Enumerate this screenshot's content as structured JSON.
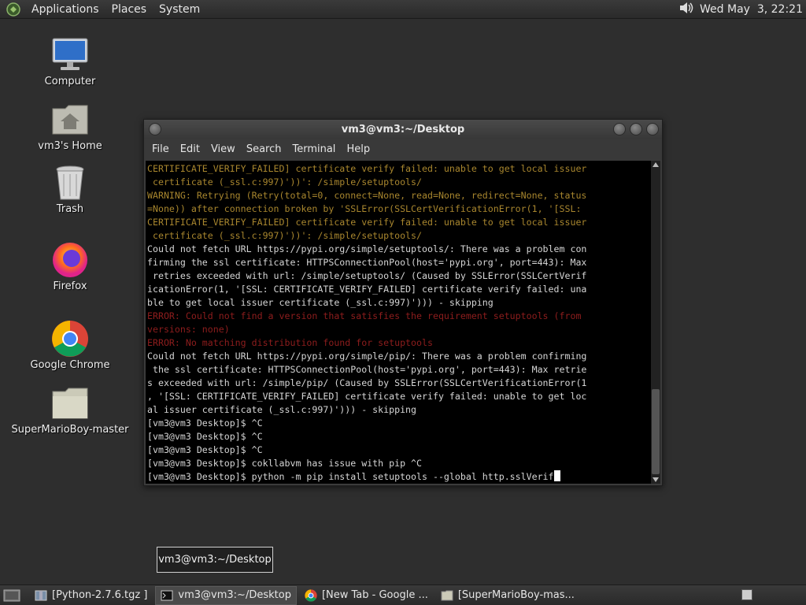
{
  "top_panel": {
    "menu": [
      "Applications",
      "Places",
      "System"
    ],
    "clock": "Wed May  3, 22:21"
  },
  "desktop_icons": [
    {
      "label": "Computer",
      "icon": "computer-icon"
    },
    {
      "label": "vm3's Home",
      "icon": "home-folder-icon"
    },
    {
      "label": "Trash",
      "icon": "trash-icon"
    },
    {
      "label": "Firefox",
      "icon": "firefox-icon"
    },
    {
      "label": "Google Chrome",
      "icon": "chrome-icon"
    },
    {
      "label": "SuperMarioBoy-master",
      "icon": "folder-icon"
    }
  ],
  "terminal": {
    "title": "vm3@vm3:~/Desktop",
    "menu": [
      "File",
      "Edit",
      "View",
      "Search",
      "Terminal",
      "Help"
    ],
    "lines": [
      {
        "t": "CERTIFICATE_VERIFY_FAILED] certificate verify failed: unable to get local issuer",
        "c": "warn"
      },
      {
        "t": " certificate (_ssl.c:997)'))': /simple/setuptools/",
        "c": "warn"
      },
      {
        "t": "WARNING: Retrying (Retry(total=0, connect=None, read=None, redirect=None, status",
        "c": "warn"
      },
      {
        "t": "=None)) after connection broken by 'SSLError(SSLCertVerificationError(1, '[SSL:",
        "c": "warn"
      },
      {
        "t": "CERTIFICATE_VERIFY_FAILED] certificate verify failed: unable to get local issuer",
        "c": "warn"
      },
      {
        "t": " certificate (_ssl.c:997)'))': /simple/setuptools/",
        "c": "warn"
      },
      {
        "t": "Could not fetch URL https://pypi.org/simple/setuptools/: There was a problem con",
        "c": "norm"
      },
      {
        "t": "firming the ssl certificate: HTTPSConnectionPool(host='pypi.org', port=443): Max",
        "c": "norm"
      },
      {
        "t": " retries exceeded with url: /simple/setuptools/ (Caused by SSLError(SSLCertVerif",
        "c": "norm"
      },
      {
        "t": "icationError(1, '[SSL: CERTIFICATE_VERIFY_FAILED] certificate verify failed: una",
        "c": "norm"
      },
      {
        "t": "ble to get local issuer certificate (_ssl.c:997)'))) - skipping",
        "c": "norm"
      },
      {
        "t": "ERROR: Could not find a version that satisfies the requirement setuptools (from",
        "c": "err"
      },
      {
        "t": "versions: none)",
        "c": "err"
      },
      {
        "t": "ERROR: No matching distribution found for setuptools",
        "c": "err"
      },
      {
        "t": "Could not fetch URL https://pypi.org/simple/pip/: There was a problem confirming",
        "c": "norm"
      },
      {
        "t": " the ssl certificate: HTTPSConnectionPool(host='pypi.org', port=443): Max retrie",
        "c": "norm"
      },
      {
        "t": "s exceeded with url: /simple/pip/ (Caused by SSLError(SSLCertVerificationError(1",
        "c": "norm"
      },
      {
        "t": ", '[SSL: CERTIFICATE_VERIFY_FAILED] certificate verify failed: unable to get loc",
        "c": "norm"
      },
      {
        "t": "al issuer certificate (_ssl.c:997)'))) - skipping",
        "c": "norm"
      },
      {
        "t": "[vm3@vm3 Desktop]$ ^C",
        "c": "norm"
      },
      {
        "t": "[vm3@vm3 Desktop]$ ^C",
        "c": "norm"
      },
      {
        "t": "[vm3@vm3 Desktop]$ ^C",
        "c": "norm"
      },
      {
        "t": "[vm3@vm3 Desktop]$ cokllabvm has issue with pip ^C",
        "c": "norm"
      },
      {
        "t": "[vm3@vm3 Desktop]$ python -m pip install setuptools --global http.sslVerif",
        "c": "norm",
        "cursor": true
      }
    ]
  },
  "tooltip": "vm3@vm3:~/Desktop",
  "taskbar": [
    {
      "label": "[Python-2.7.6.tgz ]",
      "icon": "archive-icon",
      "active": false
    },
    {
      "label": "vm3@vm3:~/Desktop",
      "icon": "terminal-icon",
      "active": true
    },
    {
      "label": "[New Tab - Google ...",
      "icon": "chrome-icon",
      "active": false
    },
    {
      "label": "[SuperMarioBoy-mas...",
      "icon": "folder-icon",
      "active": false
    }
  ],
  "colors": {
    "warn": "#a8862e",
    "error": "#8e1d1d",
    "text": "#d6d6d6"
  }
}
